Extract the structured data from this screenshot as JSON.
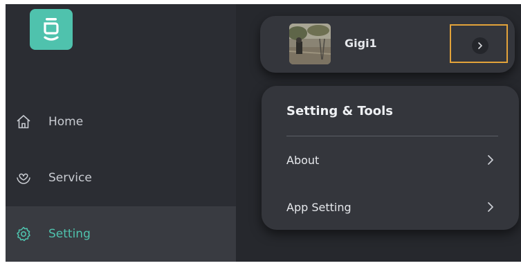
{
  "colors": {
    "accent": "#4fc2ad",
    "highlight": "#e3a33a",
    "sidebar_bg": "#2b2d33",
    "card_bg": "#34363c"
  },
  "logo": {
    "icon": "app-logo-icon"
  },
  "sidebar": {
    "items": [
      {
        "label": "Home",
        "icon": "home-icon",
        "active": false
      },
      {
        "label": "Service",
        "icon": "heart-hands-icon",
        "active": false
      },
      {
        "label": "Setting",
        "icon": "gear-icon",
        "active": true
      }
    ]
  },
  "profile": {
    "name": "Gigi1",
    "avatar": "profile-photo",
    "arrow_icon": "chevron-right-icon"
  },
  "settings": {
    "title": "Setting & Tools",
    "items": [
      {
        "label": "About",
        "icon": "chevron-right-icon"
      },
      {
        "label": "App Setting",
        "icon": "chevron-right-icon"
      }
    ]
  }
}
